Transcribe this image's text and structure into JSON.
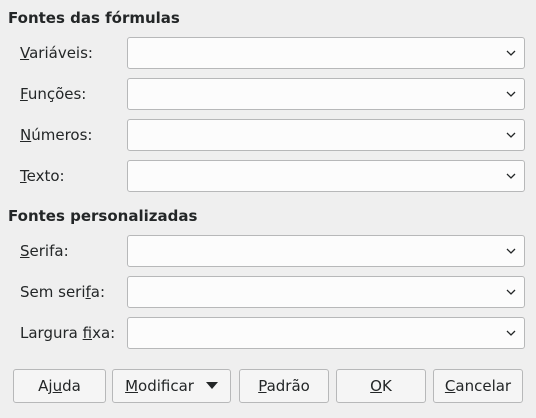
{
  "formula_fonts": {
    "title": "Fontes das fórmulas",
    "rows": [
      {
        "label_pre": "",
        "label_u": "V",
        "label_post": "ariáveis:",
        "value": ""
      },
      {
        "label_pre": "",
        "label_u": "F",
        "label_post": "unções:",
        "value": ""
      },
      {
        "label_pre": "",
        "label_u": "N",
        "label_post": "úmeros:",
        "value": ""
      },
      {
        "label_pre": "",
        "label_u": "T",
        "label_post": "exto:",
        "value": ""
      }
    ]
  },
  "custom_fonts": {
    "title": "Fontes personalizadas",
    "rows": [
      {
        "label_pre": "",
        "label_u": "S",
        "label_post": "erifa:",
        "value": ""
      },
      {
        "label_pre": "Sem seri",
        "label_u": "f",
        "label_post": "a:",
        "value": ""
      },
      {
        "label_pre": "Largura ",
        "label_u": "f",
        "label_post": "ixa:",
        "value": ""
      }
    ]
  },
  "buttons": {
    "help": {
      "pre": "Aj",
      "u": "u",
      "post": "da"
    },
    "modify": {
      "pre": "",
      "u": "M",
      "post": "odificar"
    },
    "default": {
      "pre": "",
      "u": "P",
      "post": "adrão"
    },
    "ok": {
      "pre": "",
      "u": "O",
      "post": "K"
    },
    "cancel": {
      "pre": "",
      "u": "C",
      "post": "ancelar"
    }
  },
  "icons": {
    "dropdown": "chevron-down-icon",
    "menu_arrow": "triangle-down-icon"
  }
}
